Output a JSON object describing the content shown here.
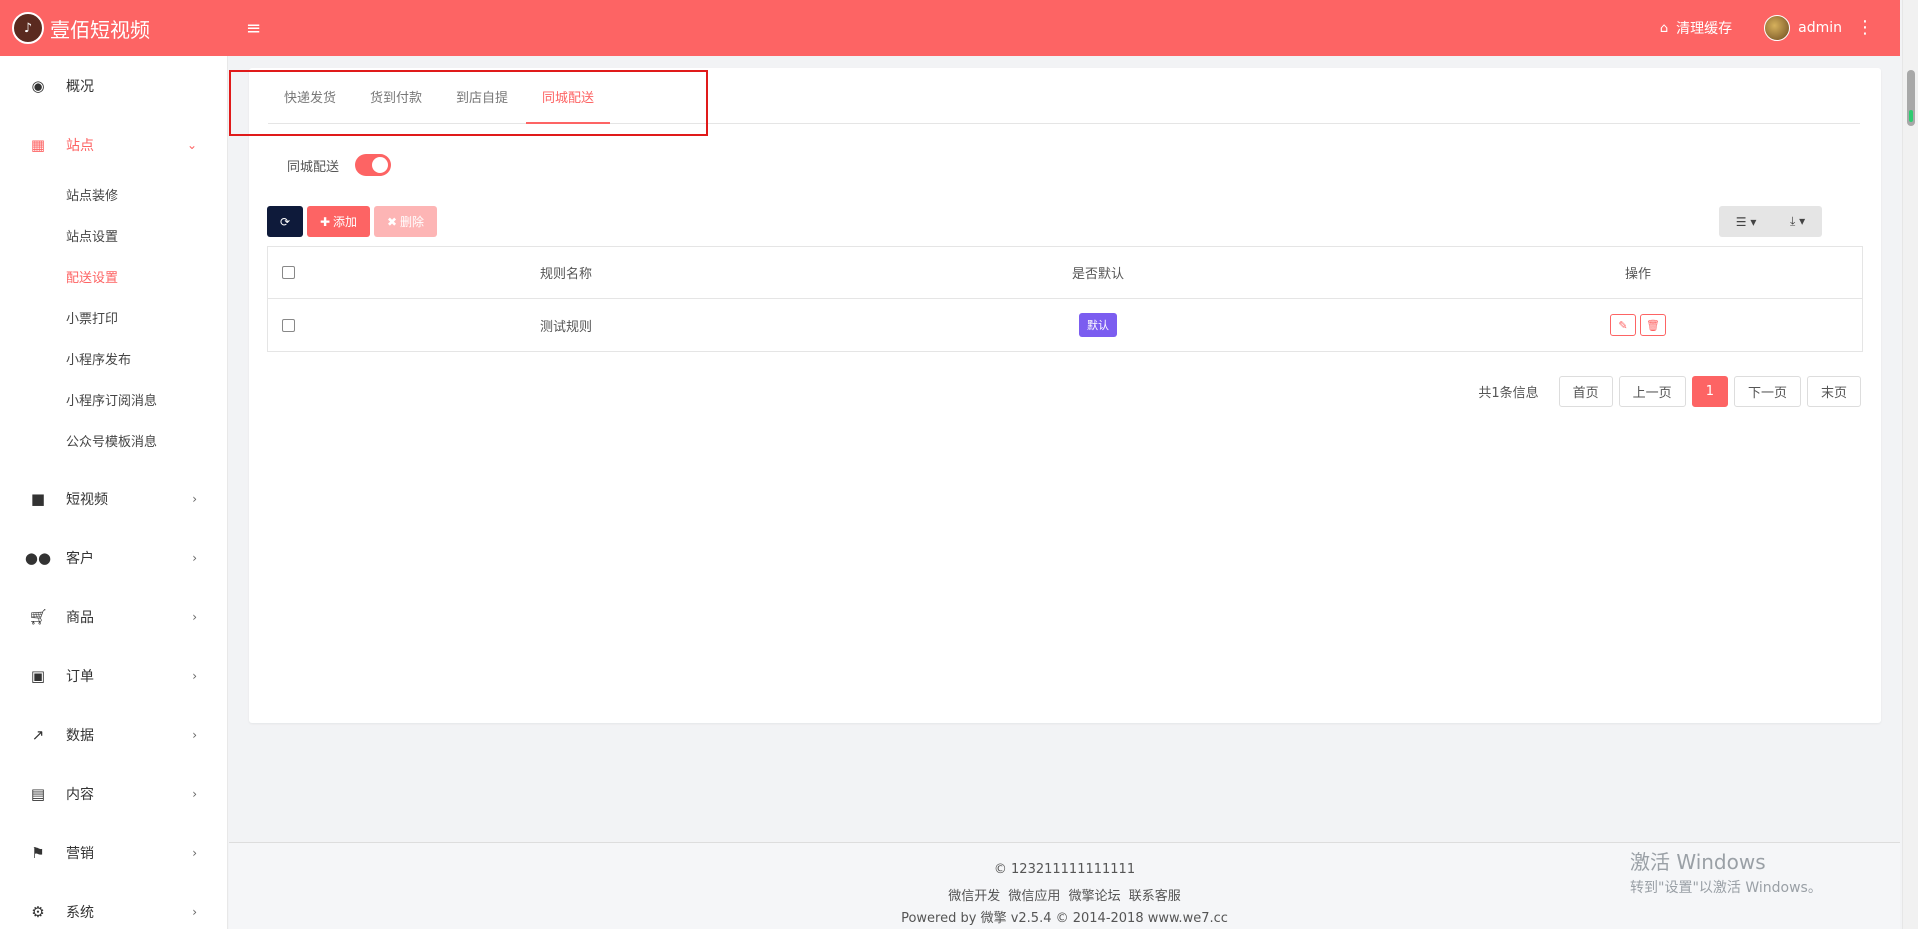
{
  "brand": {
    "title": "壹佰短视频"
  },
  "header": {
    "clear_cache": "清理缓存",
    "user": "admin"
  },
  "sidebar": {
    "items": [
      {
        "label": "概况",
        "icon": "dashboard-icon"
      },
      {
        "label": "站点",
        "icon": "grid-icon"
      },
      {
        "label": "短视频",
        "icon": "video-icon"
      },
      {
        "label": "客户",
        "icon": "users-icon"
      },
      {
        "label": "商品",
        "icon": "cart-icon"
      },
      {
        "label": "订单",
        "icon": "money-icon"
      },
      {
        "label": "数据",
        "icon": "chart-icon"
      },
      {
        "label": "内容",
        "icon": "document-icon"
      },
      {
        "label": "营销",
        "icon": "flag-icon"
      },
      {
        "label": "系统",
        "icon": "gear-icon"
      }
    ],
    "subitems": [
      "站点装修",
      "站点设置",
      "配送设置",
      "小票打印",
      "小程序发布",
      "小程序订阅消息",
      "公众号模板消息"
    ]
  },
  "tabs": [
    "快递发货",
    "货到付款",
    "到店自提",
    "同城配送"
  ],
  "switch": {
    "label": "同城配送",
    "on": true
  },
  "toolbar": {
    "add": "添加",
    "delete": "删除"
  },
  "table": {
    "headers": [
      "规则名称",
      "是否默认",
      "操作"
    ],
    "rows": [
      {
        "name": "测试规则",
        "default": "默认"
      }
    ]
  },
  "pager": {
    "total": "共1条信息",
    "first": "首页",
    "prev": "上一页",
    "current": "1",
    "next": "下一页",
    "last": "末页"
  },
  "footer": {
    "copyright": "© 123211111111111",
    "links": [
      "微信开发",
      "微信应用",
      "微擎论坛",
      "联系客服"
    ],
    "powered": "Powered by 微擎 v2.5.4 © 2014-2018 www.we7.cc"
  },
  "watermark": {
    "line1": "激活 Windows",
    "line2": "转到\"设置\"以激活 Windows。"
  },
  "colors": {
    "accent": "#fd6464",
    "badge": "#7b5df0",
    "dark_button": "#0e1a3a"
  }
}
